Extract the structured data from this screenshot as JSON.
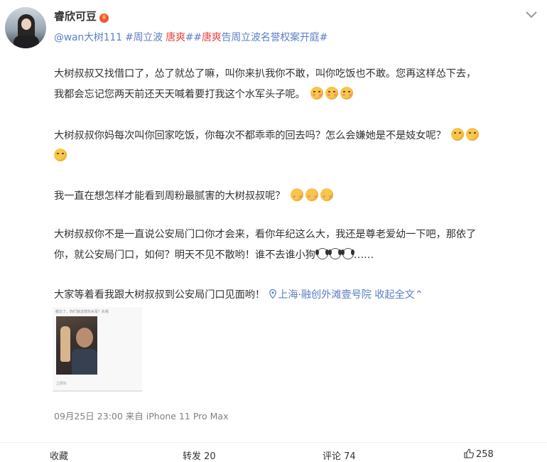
{
  "post": {
    "username": "睿欣可豆",
    "tags": {
      "mention": "@wan大树111",
      "tag1": "#周立波",
      "tag1_red": "唐爽",
      "tag2_open": "##",
      "tag2_red": "唐爽",
      "tag2_rest": "告周立波名誉权案开庭#"
    },
    "paragraphs": {
      "p1_line1": "大树叔叔又找借口了，怂了就怂了嘛，叫你来扒我你不敢，叫你吃饭也不敢。您再这样怂下去，",
      "p1_line2": "我都会忘记您两天前还天天喊着要打我这个水军头子呢。",
      "p2_line1": "大树叔叔你妈每次叫你回家吃饭，你每次不都乖乖的回去吗？怎么会嫌她是不是妓女呢？",
      "p3": "我一直在想怎样才能看到周粉最腻害的大树叔叔呢？",
      "p4_line1": "大树叔叔你不是一直说公安局门口你才会来，看你年纪这么大，我还是尊老爱幼一下吧，那依了",
      "p4_line2": "你，就公安局门口，如何？明天不见不散哟！谁不去谁小狗",
      "p4_ellipsis": "……",
      "p5": "大家等着看我跟大树叔叔到公安局门口见面哟！"
    },
    "location": "上海·融创外滩壹号院",
    "collapse": "收起全文",
    "collapse_chevron": "⌃",
    "thumbnail": {
      "caption": "都怂了，你们就这样的水军？扒呢",
      "toolbar": "立即扒"
    },
    "timestamp": "09月25日 23:00",
    "source": "来自 iPhone 11 Pro Max"
  },
  "actions": {
    "favorite": "收藏",
    "repost": "转发 20",
    "comment": "评论 74",
    "like": "258"
  },
  "icons": [
    "badge-icon",
    "chevron-down-icon",
    "location-icon",
    "like-icon",
    "emoji-icon",
    "dog-emoji-icon"
  ],
  "colors": {
    "link": "#5d7fc6",
    "tag_orange": "#eb7350",
    "tag_red": "#e8443f",
    "text": "#333333",
    "meta": "#808080"
  }
}
